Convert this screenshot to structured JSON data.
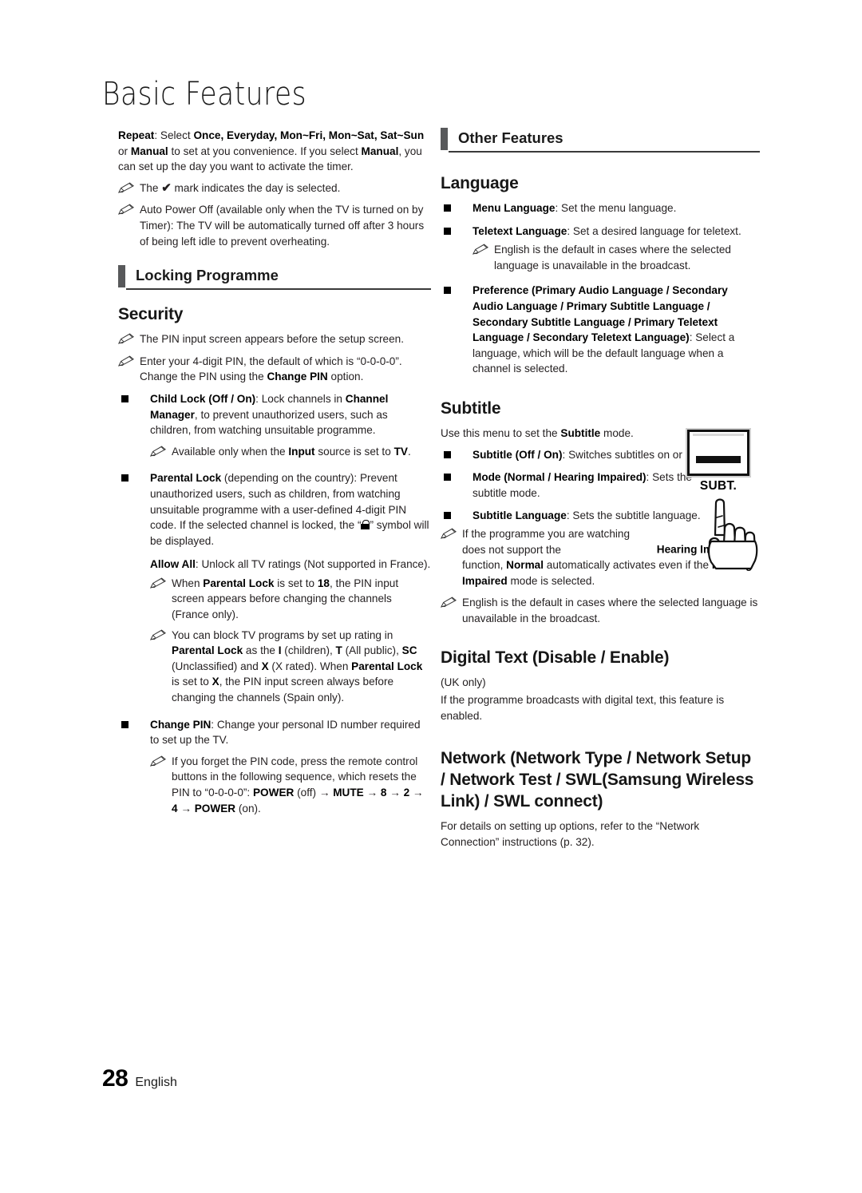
{
  "page": {
    "title": "Basic Features",
    "footer": {
      "number": "28",
      "language": "English"
    }
  },
  "left_column": {
    "repeat_paragraph": {
      "label": "Repeat",
      "text_full": "Repeat: Select Once, Everyday, Mon~Fri, Mon~Sat, Sat~Sun or Manual to set at you convenience. If you select Manual, you can set up the day you want to activate the timer."
    },
    "repeat_note": "The ✓ mark indicates the day is selected.",
    "auto_power_off_note": "Auto Power Off (available only when the TV is turned on by Timer): The TV will be automatically turned off after 3 hours of being left idle to prevent overheating.",
    "section_locking_programme": "Locking Programme",
    "subhead_security": "Security",
    "security_note_1": "The PIN input screen appears before the setup screen.",
    "security_note_2": "Enter your 4-digit PIN, the default of which is “0-0-0-0”. Change the PIN using the Change PIN option.",
    "child_lock": {
      "label": "Child Lock (Off / On)",
      "text": "Child Lock (Off / On): Lock channels in Channel Manager, to prevent unauthorized users, such as children, from watching unsuitable programme.",
      "note": "Available only when the Input source is set to TV."
    },
    "parental_lock": {
      "label": "Parental Lock",
      "text": "Parental Lock (depending on the country): Prevent unauthorized users, such as children, from watching unsuitable programme with a user-defined 4-digit PIN code. If the selected channel is locked, the “🔒” symbol will be displayed.",
      "allow_all": "Allow All: Unlock all TV ratings (Not supported in France).",
      "note_1": "When Parental Lock is set to 18, the PIN input screen appears before changing the channels (France only).",
      "note_2": "You can block TV programs by set up rating in Parental Lock as the I (children), T (All public), SC (Unclassified) and X (X rated). When Parental Lock is set to X, the PIN input screen always before changing the channels (Spain only)."
    },
    "change_pin": {
      "label": "Change PIN",
      "text": "Change PIN: Change your personal ID number required to set up the TV.",
      "note": "If you forget the PIN code, press the remote control buttons in the following sequence, which resets the PIN to “0-0-0-0”: POWER (off) → MUTE → 8 → 2 → 4 → POWER (on)."
    }
  },
  "right_column": {
    "section_other_features": "Other Features",
    "subhead_language": "Language",
    "menu_language": "Menu Language: Set the menu language.",
    "teletext_language": "Teletext Language: Set a desired language for teletext.",
    "teletext_note": "English is the default in cases where the selected language is unavailable in the broadcast.",
    "preference": "Preference (Primary Audio Language / Secondary Audio Language / Primary Subtitle Language / Secondary Subtitle Language / Primary Teletext Language / Secondary Teletext Language): Select a language, which will be the default language when a channel is selected.",
    "subhead_subtitle": "Subtitle",
    "subtitle_intro": "Use this menu to set the Subtitle mode.",
    "subtitle_onoff": "Subtitle (Off / On): Switches subtitles on or off.",
    "subtitle_mode": "Mode (Normal / Hearing Impaired): Sets the subtitle mode.",
    "subtitle_language": "Subtitle Language: Sets the subtitle language.",
    "subtitle_note_1": "If the programme you are watching does not support the Hearing Impaired function, Normal automatically activates even if the Hearing Impaired mode is selected.",
    "subtitle_note_2": "English is the default in cases where the selected language is unavailable in the broadcast.",
    "subt_button_label": "SUBT.",
    "subhead_digital_text": "Digital Text (Disable / Enable)",
    "digital_text_uk": "(UK only)",
    "digital_text_body": "If the programme broadcasts with digital text, this feature is enabled.",
    "subhead_network": "Network (Network Type / Network Setup / Network Test / SWL(Samsung Wireless Link) / SWL connect)",
    "network_body": "For details on setting up options, refer to the “Network Connection” instructions (p. 32)."
  },
  "colors": {
    "section_bar": "#58595b",
    "rule_dark": "#3a3a3a",
    "text": "#231f20"
  }
}
